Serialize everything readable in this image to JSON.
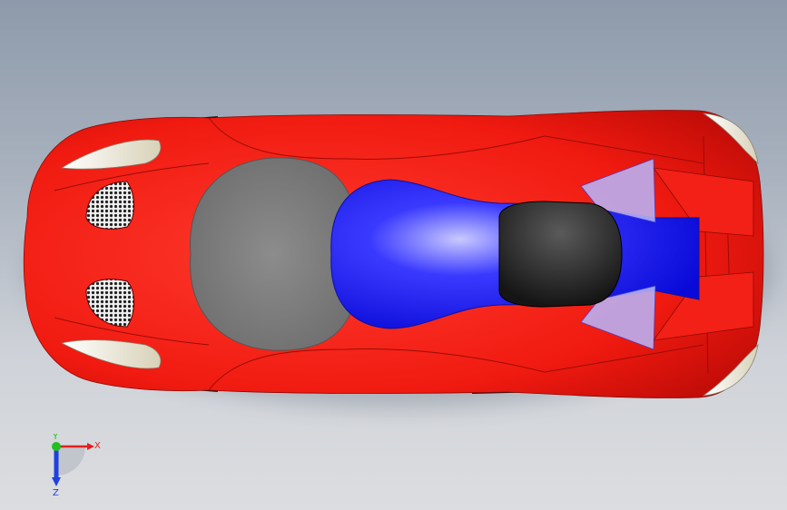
{
  "viewport": {
    "background_top": "#8e9aab",
    "background_bottom": "#dcdde0"
  },
  "model": {
    "body_color": "#ff2a1f",
    "canopy_color": "#1a10ff",
    "windshield_color": "#7a7a7a",
    "engine_cover_color": "#2a2a2a",
    "light_color": "#f3efdc"
  },
  "triad": {
    "x_label": "X",
    "y_label": "Y",
    "z_label": "Z",
    "x_color": "#e02020",
    "y_color": "#20c020",
    "z_color": "#2040e0"
  }
}
